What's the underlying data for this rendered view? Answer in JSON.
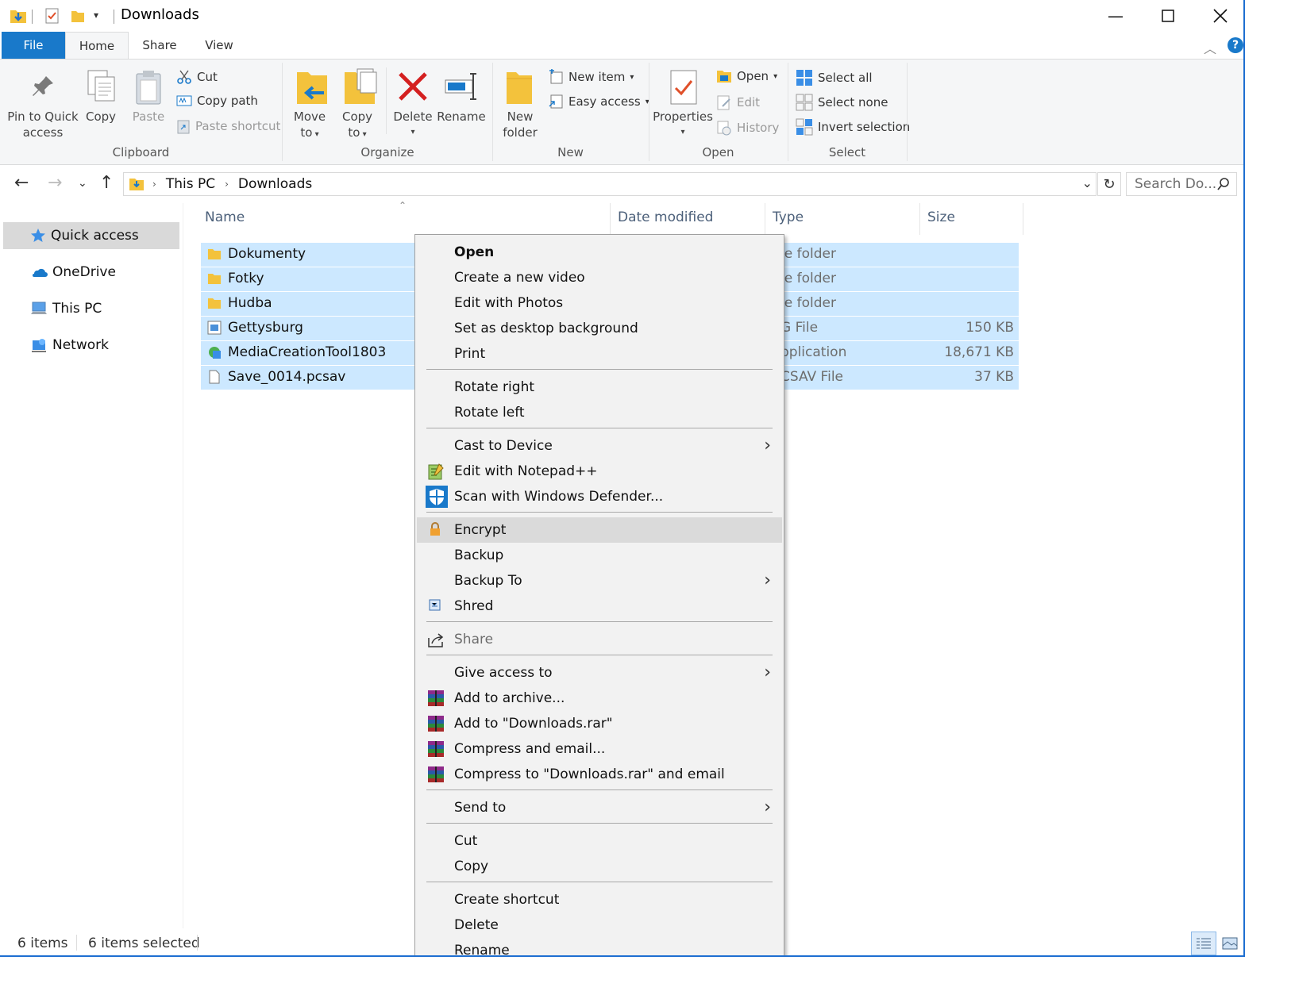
{
  "window": {
    "title": "Downloads"
  },
  "tabs": [
    {
      "label": "File"
    },
    {
      "label": "Home"
    },
    {
      "label": "Share"
    },
    {
      "label": "View"
    }
  ],
  "ribbon": {
    "clipboard": {
      "pin_line1": "Pin to Quick",
      "pin_line2": "access",
      "copy": "Copy",
      "paste": "Paste",
      "cut": "Cut",
      "copy_path": "Copy path",
      "paste_shortcut": "Paste shortcut",
      "group": "Clipboard"
    },
    "organize": {
      "move_line1": "Move",
      "move_line2": "to",
      "copy_line1": "Copy",
      "copy_line2": "to",
      "delete": "Delete",
      "rename": "Rename",
      "group": "Organize"
    },
    "new": {
      "folder_line1": "New",
      "folder_line2": "folder",
      "new_item": "New item",
      "easy_access": "Easy access",
      "group": "New"
    },
    "open": {
      "properties": "Properties",
      "open": "Open",
      "edit": "Edit",
      "history": "History",
      "group": "Open"
    },
    "select": {
      "select_all": "Select all",
      "select_none": "Select none",
      "invert_selection": "Invert selection",
      "group": "Select"
    }
  },
  "address": {
    "crumbs": [
      "This PC",
      "Downloads"
    ],
    "search_placeholder": "Search Do..."
  },
  "nav_pane": [
    {
      "label": "Quick access",
      "icon": "star-icon",
      "selected": true
    },
    {
      "label": "OneDrive",
      "icon": "cloud-icon",
      "selected": false
    },
    {
      "label": "This PC",
      "icon": "computer-icon",
      "selected": false
    },
    {
      "label": "Network",
      "icon": "network-icon",
      "selected": false
    }
  ],
  "columns": {
    "name": "Name",
    "date_modified": "Date modified",
    "type": "Type",
    "size": "Size"
  },
  "files": [
    {
      "name": "Dokumenty",
      "type": "le folder",
      "size": "",
      "icon": "folder-icon"
    },
    {
      "name": "Fotky",
      "type": "le folder",
      "size": "",
      "icon": "folder-icon"
    },
    {
      "name": "Hudba",
      "type": "le folder",
      "size": "",
      "icon": "folder-icon"
    },
    {
      "name": "Gettysburg",
      "type": "G File",
      "size": "150 KB",
      "icon": "image-file-icon"
    },
    {
      "name": "MediaCreationTool1803",
      "type": "pplication",
      "size": "18,671 KB",
      "icon": "app-icon"
    },
    {
      "name": "Save_0014.pcsav",
      "type": "CSAV File",
      "size": "37 KB",
      "icon": "file-icon"
    }
  ],
  "status": {
    "items": "6 items",
    "selected": "6 items selected"
  },
  "context_menu": {
    "open": "Open",
    "create_video": "Create a new video",
    "edit_photos": "Edit with Photos",
    "set_background": "Set as desktop background",
    "print": "Print",
    "rotate_right": "Rotate right",
    "rotate_left": "Rotate left",
    "cast": "Cast to Device",
    "notepad": "Edit with Notepad++",
    "defender": "Scan with Windows Defender...",
    "encrypt": "Encrypt",
    "backup": "Backup",
    "backup_to": "Backup To",
    "shred": "Shred",
    "share": "Share",
    "give_access": "Give access to",
    "add_archive": "Add to archive...",
    "add_rar": "Add to \"Downloads.rar\"",
    "compress_email": "Compress and email...",
    "compress_rar_email": "Compress to \"Downloads.rar\" and email",
    "send_to": "Send to",
    "cut": "Cut",
    "copy": "Copy",
    "create_shortcut": "Create shortcut",
    "delete": "Delete",
    "rename": "Rename"
  },
  "colors": {
    "file_tab": "#1979ca",
    "selection": "#cce8ff",
    "menu_highlight": "#dadada",
    "window_border": "#1e6fd1"
  }
}
